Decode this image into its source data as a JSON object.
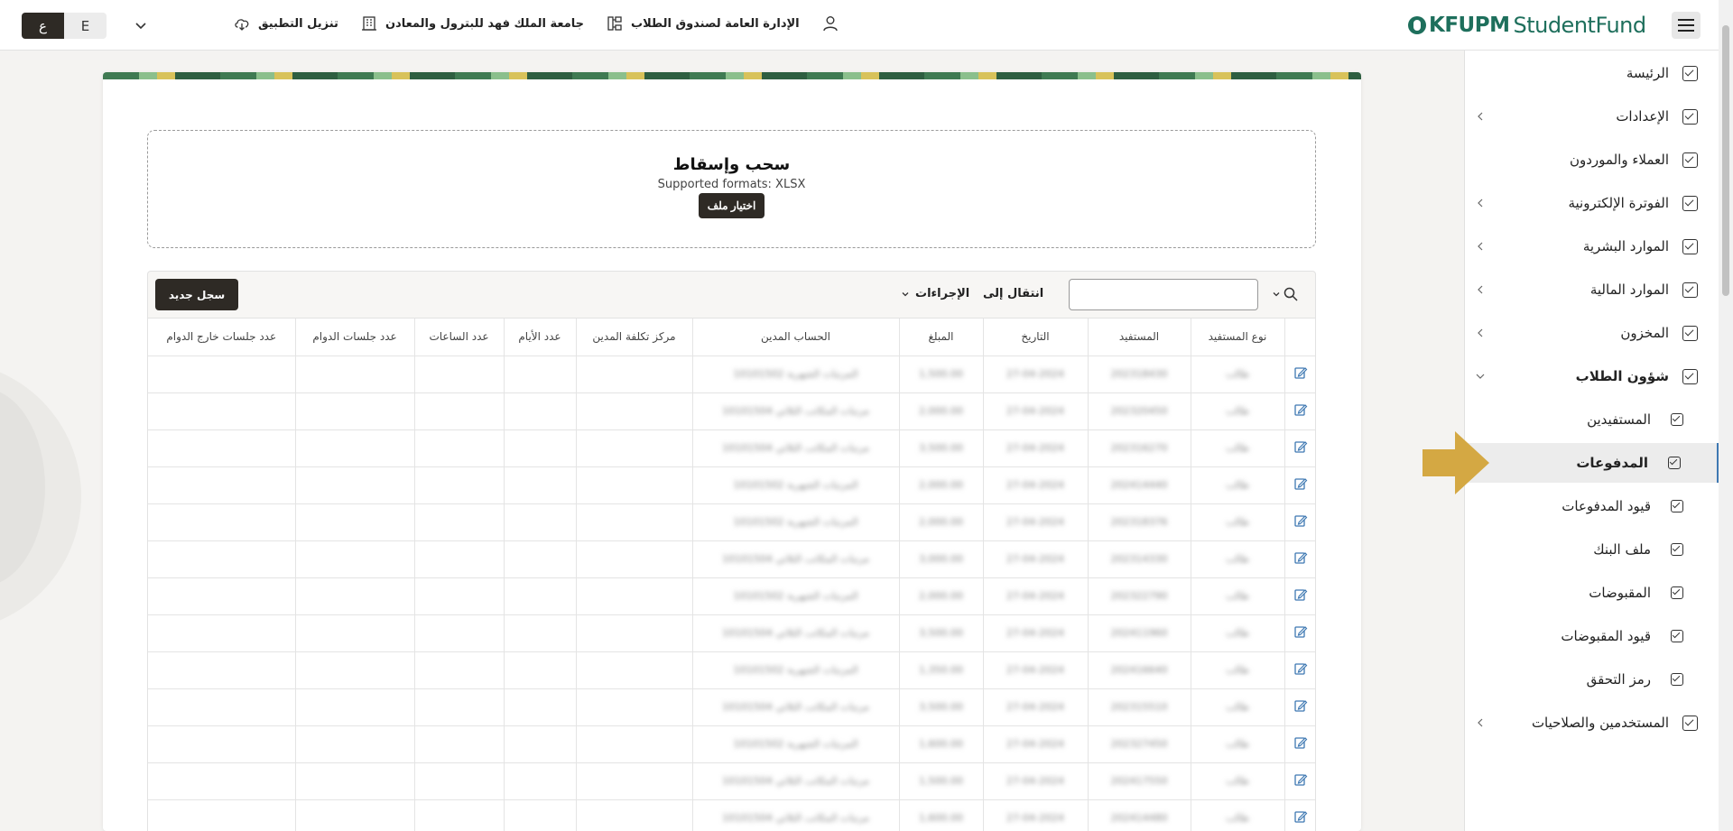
{
  "header": {
    "lang_ar": "ع",
    "lang_en": "E",
    "links": [
      {
        "label": "تنزيل التطبيق",
        "icon": "cloud-download-icon"
      },
      {
        "label": "جامعة الملك فهد للبترول والمعادن",
        "icon": "building-icon"
      },
      {
        "label": "الإدارة العامة لصندوق الطلاب",
        "icon": "org-chart-icon"
      }
    ],
    "user_icon": "user-icon",
    "logo_kfupm": "KFUPM",
    "logo_studentfund": "StudentFund"
  },
  "sidebar": {
    "items": [
      {
        "label": "الرئيسة",
        "chevron": false
      },
      {
        "label": "الإعدادات",
        "chevron": true
      },
      {
        "label": "العملاء والموردون",
        "chevron": false
      },
      {
        "label": "الفوترة الإلكترونية",
        "chevron": true
      },
      {
        "label": "الموارد البشرية",
        "chevron": true
      },
      {
        "label": "الموارد المالية",
        "chevron": true
      },
      {
        "label": "المخزون",
        "chevron": true
      },
      {
        "label": "شؤون الطلاب",
        "chevron": "down"
      },
      {
        "label": "المستفيدين",
        "sub": true
      },
      {
        "label": "المدفوعات",
        "sub": true,
        "active": true
      },
      {
        "label": "قيود المدفوعات",
        "sub": true
      },
      {
        "label": "ملف البنك",
        "sub": true
      },
      {
        "label": "المقبوضات",
        "sub": true
      },
      {
        "label": "قيود المقبوضات",
        "sub": true
      },
      {
        "label": "رمز التحقق",
        "sub": true
      },
      {
        "label": "المستخدمين والصلاحيات",
        "chevron": true
      }
    ],
    "highlight_color": "#d4a843"
  },
  "upload": {
    "title": "سحب وإسقاط",
    "formats": "Supported formats: XLSX",
    "choose_button": "اختيار ملف"
  },
  "grid": {
    "new_record_button": "سجل جديد",
    "actions_label": "الإجراءات",
    "goto_label": "انتقال إلى",
    "search_value": "",
    "columns": [
      "نوع المستفيد",
      "المستفيد",
      "التاريخ",
      "المبلغ",
      "الحساب المدين",
      "مركز تكلفة المدين",
      "عدد الأيام",
      "عدد الساعات",
      "عدد جلسات الدوام",
      "عدد جلسات خارج الدوام"
    ],
    "rows": [
      [
        "طالب",
        "202318430",
        "27-04-2024",
        "1,500.00",
        "10101502 المرتبات الشهرية"
      ],
      [
        "طالب",
        "202320450",
        "27-04-2024",
        "2,000.00",
        "10101504 مرتبات المكاتب الثلاثي"
      ],
      [
        "طالب",
        "202316270",
        "27-04-2024",
        "3,500.00",
        "10101504 مرتبات المكاتب الثلاثي"
      ],
      [
        "طالب",
        "202414440",
        "27-04-2024",
        "2,000.00",
        "10101502 المرتبات الشهرية"
      ],
      [
        "طالب",
        "202318376",
        "27-04-2024",
        "2,000.00",
        "10101502 المرتبات الشهرية"
      ],
      [
        "طالب",
        "202314330",
        "27-04-2024",
        "3,000.00",
        "10101504 مرتبات المكاتب الثلاثي"
      ],
      [
        "طالب",
        "202322790",
        "27-04-2024",
        "2,000.00",
        "10101502 المرتبات الشهرية"
      ],
      [
        "طالب",
        "202411960",
        "27-04-2024",
        "3,500.00",
        "10101504 مرتبات المكاتب الثلاثي"
      ],
      [
        "طالب",
        "202416640",
        "27-04-2024",
        "1,350.00",
        "10101502 المرتبات الشهرية"
      ],
      [
        "طالب",
        "202315510",
        "27-04-2024",
        "3,500.00",
        "10101504 مرتبات المكاتب الثلاثي"
      ],
      [
        "طالب",
        "202327450",
        "27-04-2024",
        "1,600.00",
        "10101502 المرتبات الشهرية"
      ],
      [
        "طالب",
        "202417550",
        "27-04-2024",
        "1,500.00",
        "10101504 مرتبات المكاتب الثلاثي"
      ],
      [
        "طالب",
        "202414480",
        "27-04-2024",
        "1,600.00",
        "10101504 مرتبات المكاتب الثلاثي"
      ]
    ]
  }
}
